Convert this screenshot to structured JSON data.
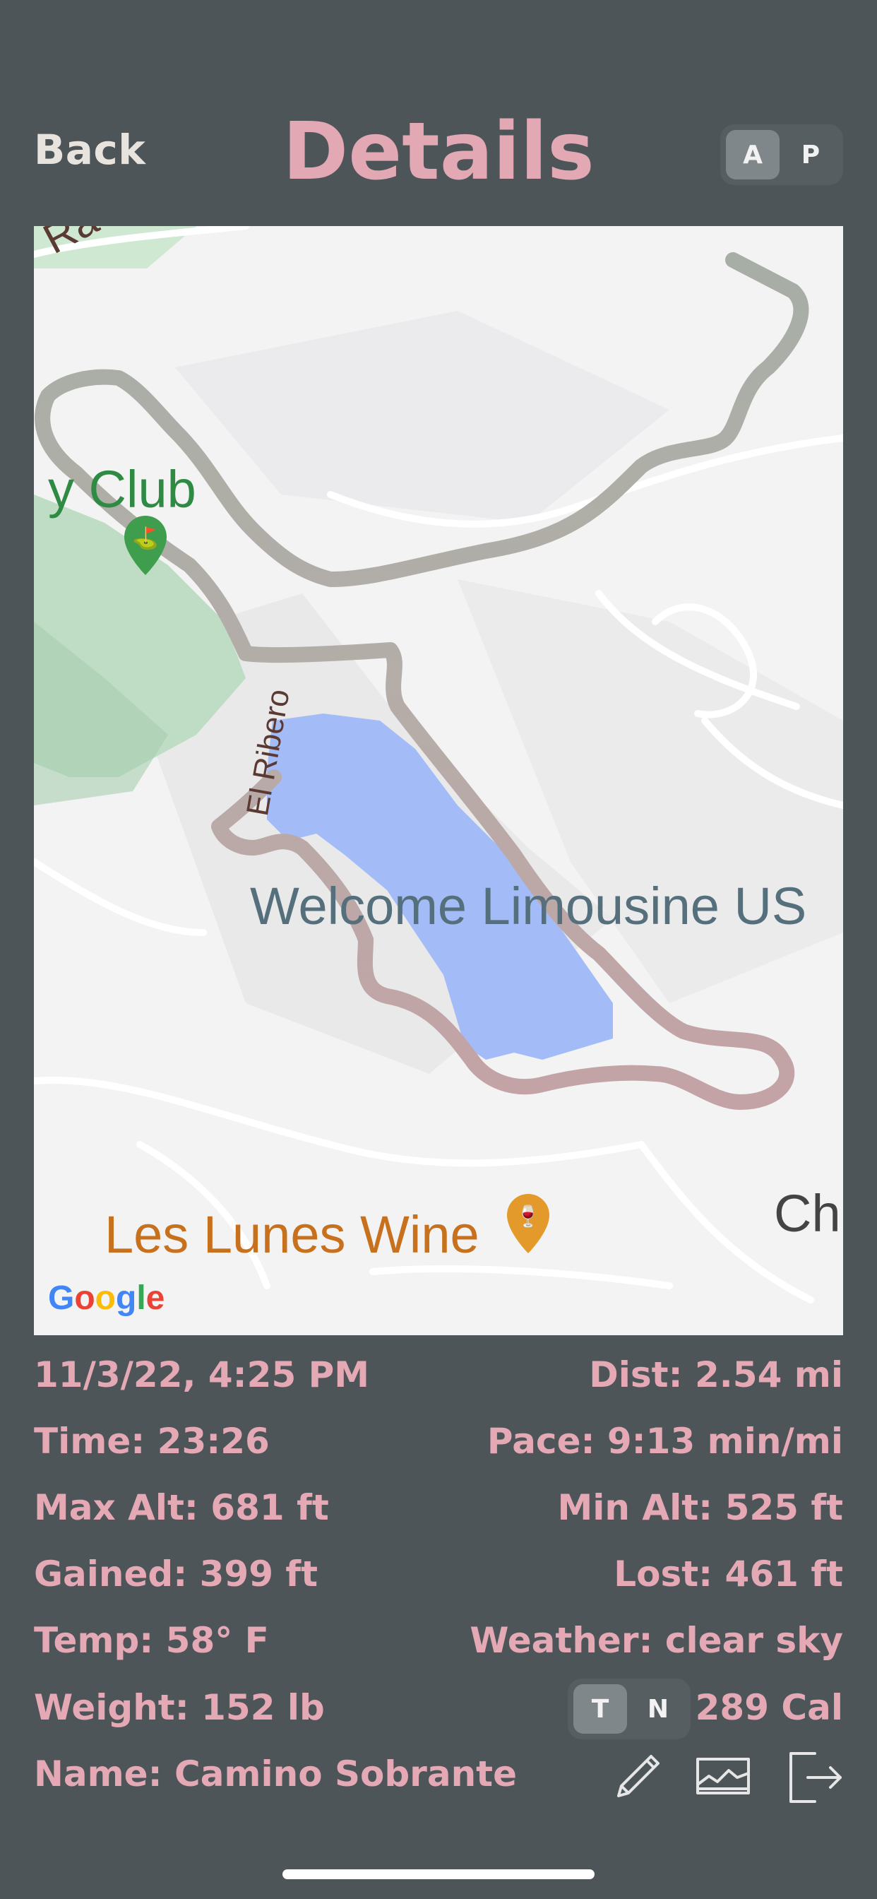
{
  "header": {
    "back_label": "Back",
    "title": "Details",
    "mode_toggle": [
      {
        "label": "A",
        "selected": true
      },
      {
        "label": "P",
        "selected": false
      }
    ]
  },
  "map": {
    "labels": {
      "club": "y Club",
      "welcome": "Welcome Limousine US",
      "wine": "Les Lunes Wine",
      "ch": "Ch",
      "road_top": "Ra",
      "road_el_ribero": "El Ribero"
    },
    "attribution": "Google",
    "colors": {
      "water": "#a3bcf7",
      "park": "#cfe8d2",
      "route_start": "#a7aea6",
      "route_end": "#c4a3a6"
    }
  },
  "stats": {
    "date": "11/3/22, 4:25 PM",
    "distance": "Dist: 2.54 mi",
    "time": "Time: 23:26",
    "pace": "Pace: 9:13 min/mi",
    "max_alt": "Max Alt: 681 ft",
    "min_alt": "Min Alt: 525 ft",
    "gained": "Gained: 399 ft",
    "lost": "Lost: 461 ft",
    "temp": "Temp: 58° F",
    "weather": "Weather: clear sky",
    "weight": "Weight: 152 lb",
    "calories": "289 Cal",
    "name": "Name: Camino Sobrante"
  },
  "calorie_toggle": [
    {
      "label": "T",
      "selected": true
    },
    {
      "label": "N",
      "selected": false
    }
  ],
  "actions": {
    "edit_icon": "pencil-icon",
    "chart_icon": "elevation-chart-icon",
    "export_icon": "export-icon"
  }
}
